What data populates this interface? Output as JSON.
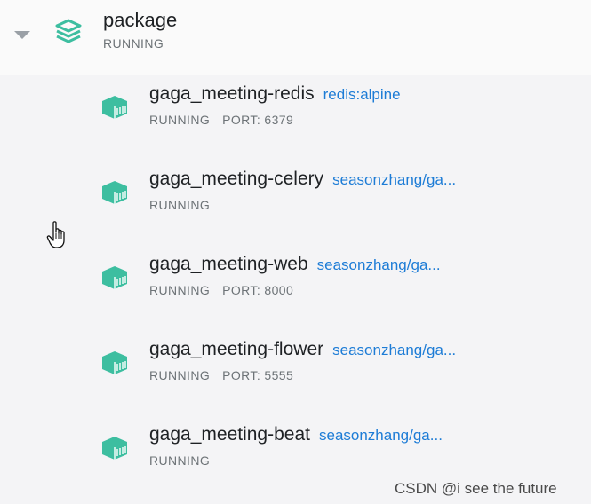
{
  "group": {
    "title": "package",
    "status": "RUNNING",
    "icon": "stack-icon",
    "accent_color": "#3dbea0"
  },
  "containers": [
    {
      "name": "gaga_meeting-redis",
      "image": "redis:alpine",
      "status": "RUNNING",
      "port": "PORT: 6379"
    },
    {
      "name": "gaga_meeting-celery",
      "image": "seasonzhang/ga...",
      "status": "RUNNING",
      "port": ""
    },
    {
      "name": "gaga_meeting-web",
      "image": "seasonzhang/ga...",
      "status": "RUNNING",
      "port": "PORT: 8000"
    },
    {
      "name": "gaga_meeting-flower",
      "image": "seasonzhang/ga...",
      "status": "RUNNING",
      "port": "PORT: 5555"
    },
    {
      "name": "gaga_meeting-beat",
      "image": "seasonzhang/ga...",
      "status": "RUNNING",
      "port": ""
    }
  ],
  "watermark": "CSDN @i see the future",
  "colors": {
    "link": "#1d7cd6",
    "container_icon": "#3dbea0",
    "text_primary": "#1e2124",
    "text_secondary": "#6d7377"
  }
}
